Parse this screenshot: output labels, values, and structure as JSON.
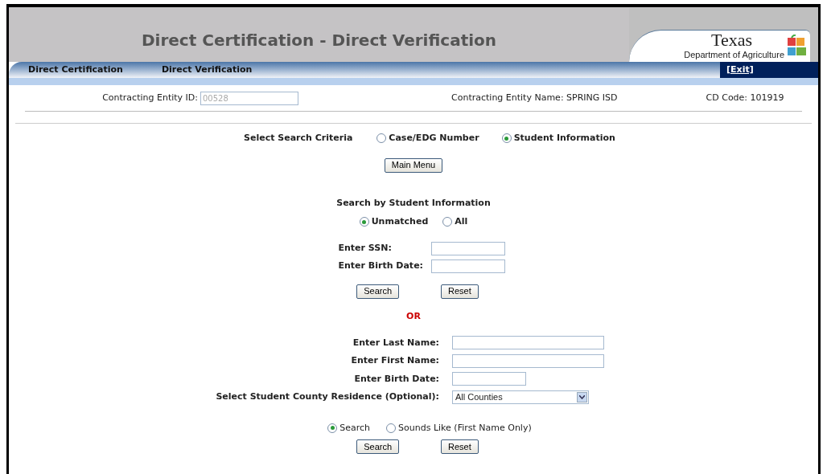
{
  "header": {
    "title": "Direct Certification - Direct Verification",
    "logo": {
      "name": "Texas",
      "subtitle": "Department of Agriculture"
    }
  },
  "nav": {
    "items": [
      "Direct Certification",
      "Direct Verification"
    ],
    "exit": "[Exit]"
  },
  "entity": {
    "id_label": "Contracting Entity ID:",
    "id_value": "00528",
    "name": "Contracting Entity Name: SPRING ISD",
    "cd_code": "CD Code: 101919"
  },
  "criteria": {
    "label": "Select Search Criteria",
    "options": [
      {
        "label": "Case/EDG Number",
        "selected": false
      },
      {
        "label": "Student Information",
        "selected": true
      }
    ]
  },
  "main_menu": "Main Menu",
  "student_search": {
    "title": "Search by Student Information",
    "filter": [
      {
        "label": "Unmatched",
        "selected": true
      },
      {
        "label": "All",
        "selected": false
      }
    ],
    "fields": [
      {
        "label": "Enter SSN:"
      },
      {
        "label": "Enter Birth Date:"
      }
    ],
    "buttons": [
      "Search",
      "Reset"
    ]
  },
  "or": "OR",
  "name_search": {
    "fields": [
      {
        "label": "Enter Last Name:",
        "kind": "wide"
      },
      {
        "label": "Enter First Name:",
        "kind": "wide"
      },
      {
        "label": "Enter Birth Date:",
        "kind": "short"
      },
      {
        "label": "Select Student County Residence (Optional):",
        "kind": "select",
        "value": "All Counties"
      }
    ],
    "mode": [
      {
        "label": "Search",
        "selected": true
      },
      {
        "label": "Sounds Like (First Name Only)",
        "selected": false
      }
    ],
    "buttons": [
      "Search",
      "Reset"
    ]
  }
}
